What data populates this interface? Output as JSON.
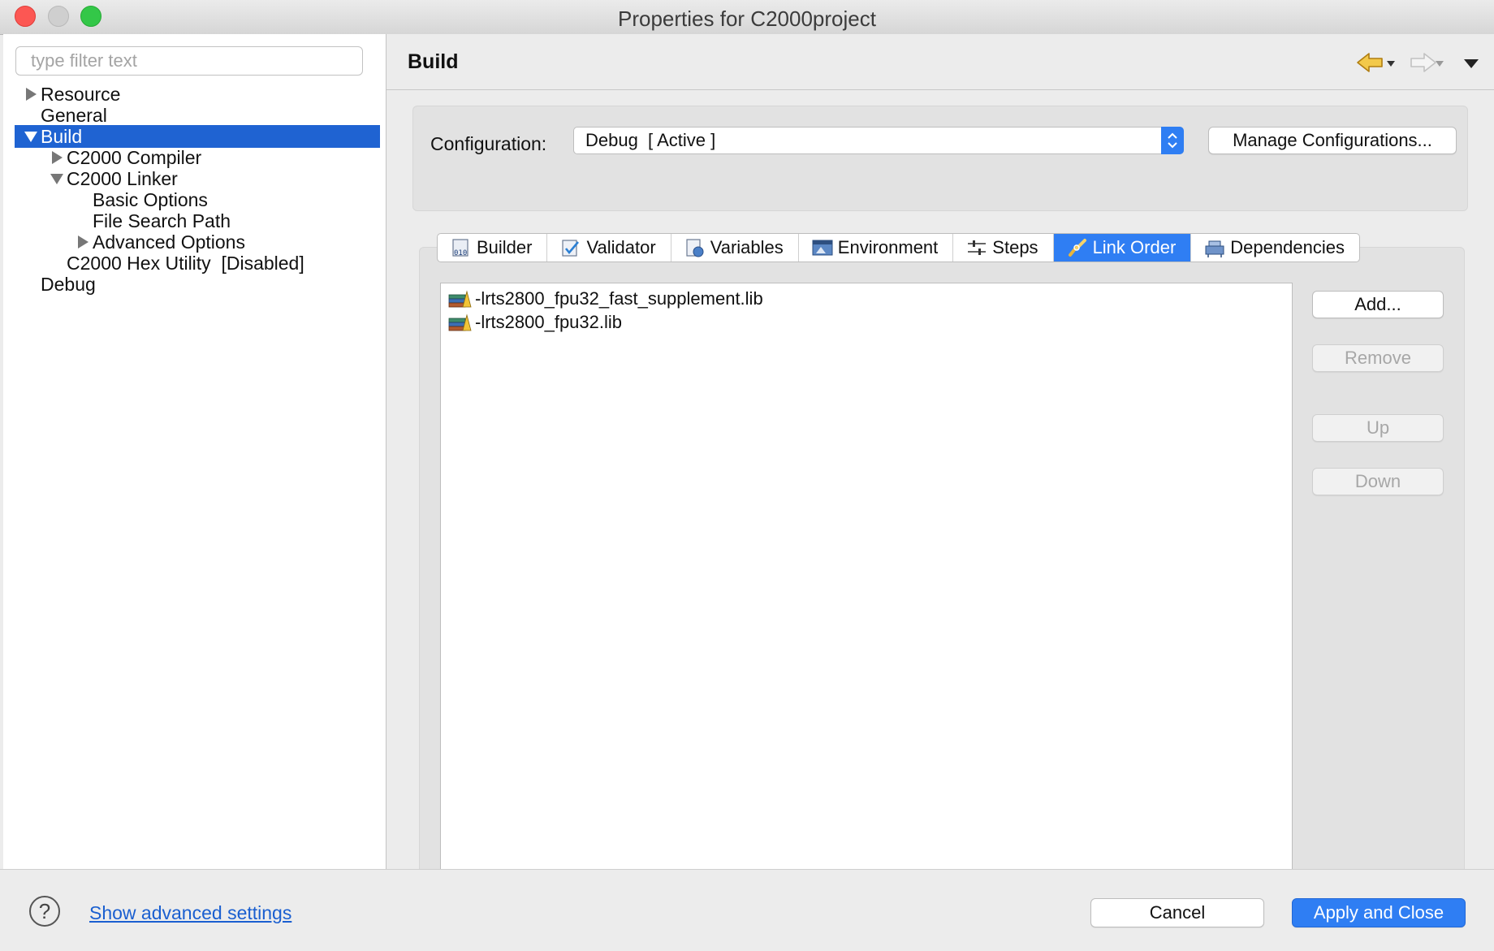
{
  "window": {
    "title": "Properties for C2000project"
  },
  "sidebar": {
    "filter_placeholder": "type filter text",
    "items": [
      {
        "label": "Resource"
      },
      {
        "label": "General"
      },
      {
        "label": "Build"
      },
      {
        "label": "C2000 Compiler"
      },
      {
        "label": "C2000 Linker"
      },
      {
        "label": "Basic Options"
      },
      {
        "label": "File Search Path"
      },
      {
        "label": "Advanced Options"
      },
      {
        "label": "C2000 Hex Utility  [Disabled]"
      },
      {
        "label": "Debug"
      }
    ]
  },
  "page": {
    "title": "Build",
    "configuration_label": "Configuration:",
    "configuration_value": "Debug  [ Active ]",
    "manage_label": "Manage Configurations..."
  },
  "tabs": [
    {
      "label": "Builder",
      "icon": "builder-icon"
    },
    {
      "label": "Validator",
      "icon": "validator-icon"
    },
    {
      "label": "Variables",
      "icon": "variables-icon"
    },
    {
      "label": "Environment",
      "icon": "environment-icon"
    },
    {
      "label": "Steps",
      "icon": "steps-icon"
    },
    {
      "label": "Link Order",
      "icon": "link-order-icon"
    },
    {
      "label": "Dependencies",
      "icon": "dependencies-icon"
    }
  ],
  "active_tab": "Link Order",
  "link_order": {
    "items": [
      {
        "label": "-lrts2800_fpu32_fast_supplement.lib"
      },
      {
        "label": "-lrts2800_fpu32.lib"
      }
    ],
    "buttons": {
      "add": "Add...",
      "remove": "Remove",
      "up": "Up",
      "down": "Down"
    }
  },
  "footer": {
    "help_symbol": "?",
    "advanced_link": "Show advanced settings",
    "cancel": "Cancel",
    "apply_close": "Apply and Close"
  },
  "colors": {
    "accent": "#2f7ef3",
    "selection": "#1f63d2",
    "link": "#1a5fd0"
  }
}
